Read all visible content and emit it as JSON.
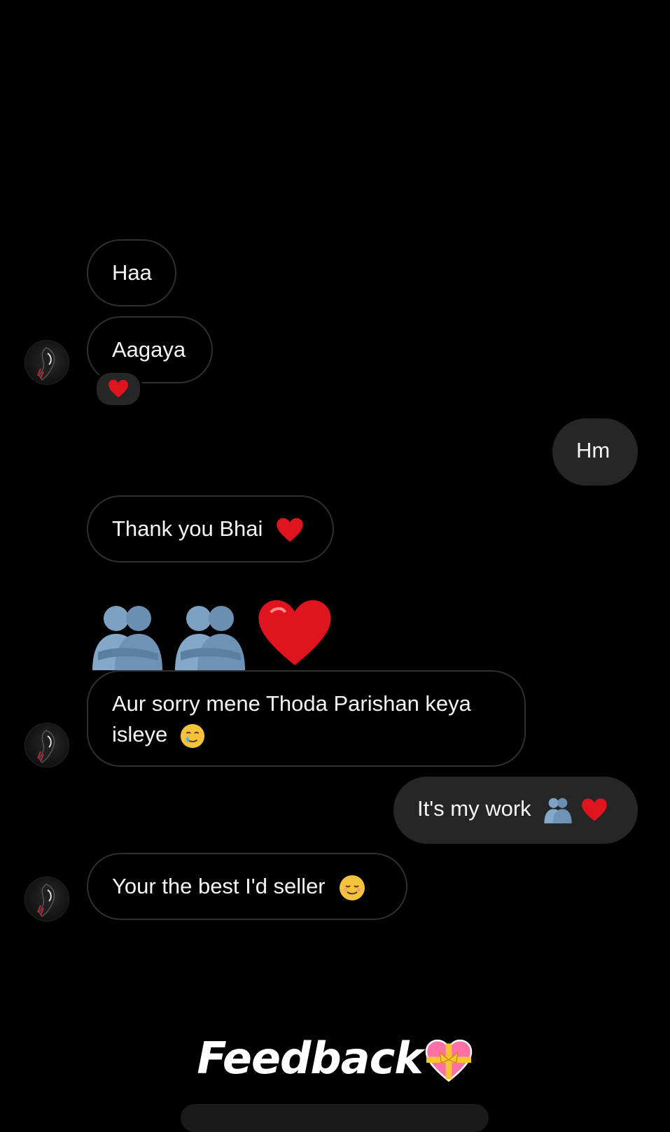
{
  "messages": {
    "m1": {
      "text": "Haa"
    },
    "m2": {
      "text": "Aagaya",
      "reaction": "heart-emoji"
    },
    "m3": {
      "text": "Hm"
    },
    "m4": {
      "text": "Thank you Bhai",
      "emoji": "heart-emoji"
    },
    "m5": {
      "emojis": [
        "people-hugging-emoji",
        "people-hugging-emoji",
        "heart-emoji"
      ]
    },
    "m6": {
      "line1": "Aur sorry mene Thoda Parishan keya",
      "line2": "isleye",
      "emoji": "smiling-face-with-tear-emoji"
    },
    "m7": {
      "text": "It's my work",
      "emojis": [
        "people-hugging-emoji",
        "heart-emoji"
      ]
    },
    "m8": {
      "text": "Your the best I'd seller",
      "emoji": "smiling-face-emoji"
    }
  },
  "caption": {
    "text": "Feedback",
    "icon": "heart-with-ribbon-emoji"
  },
  "colors": {
    "background": "#000000",
    "incoming_border": "#2f2f2f",
    "outgoing_bubble": "#262626",
    "heart": "#e0141e",
    "hug": "#6e93b5"
  }
}
